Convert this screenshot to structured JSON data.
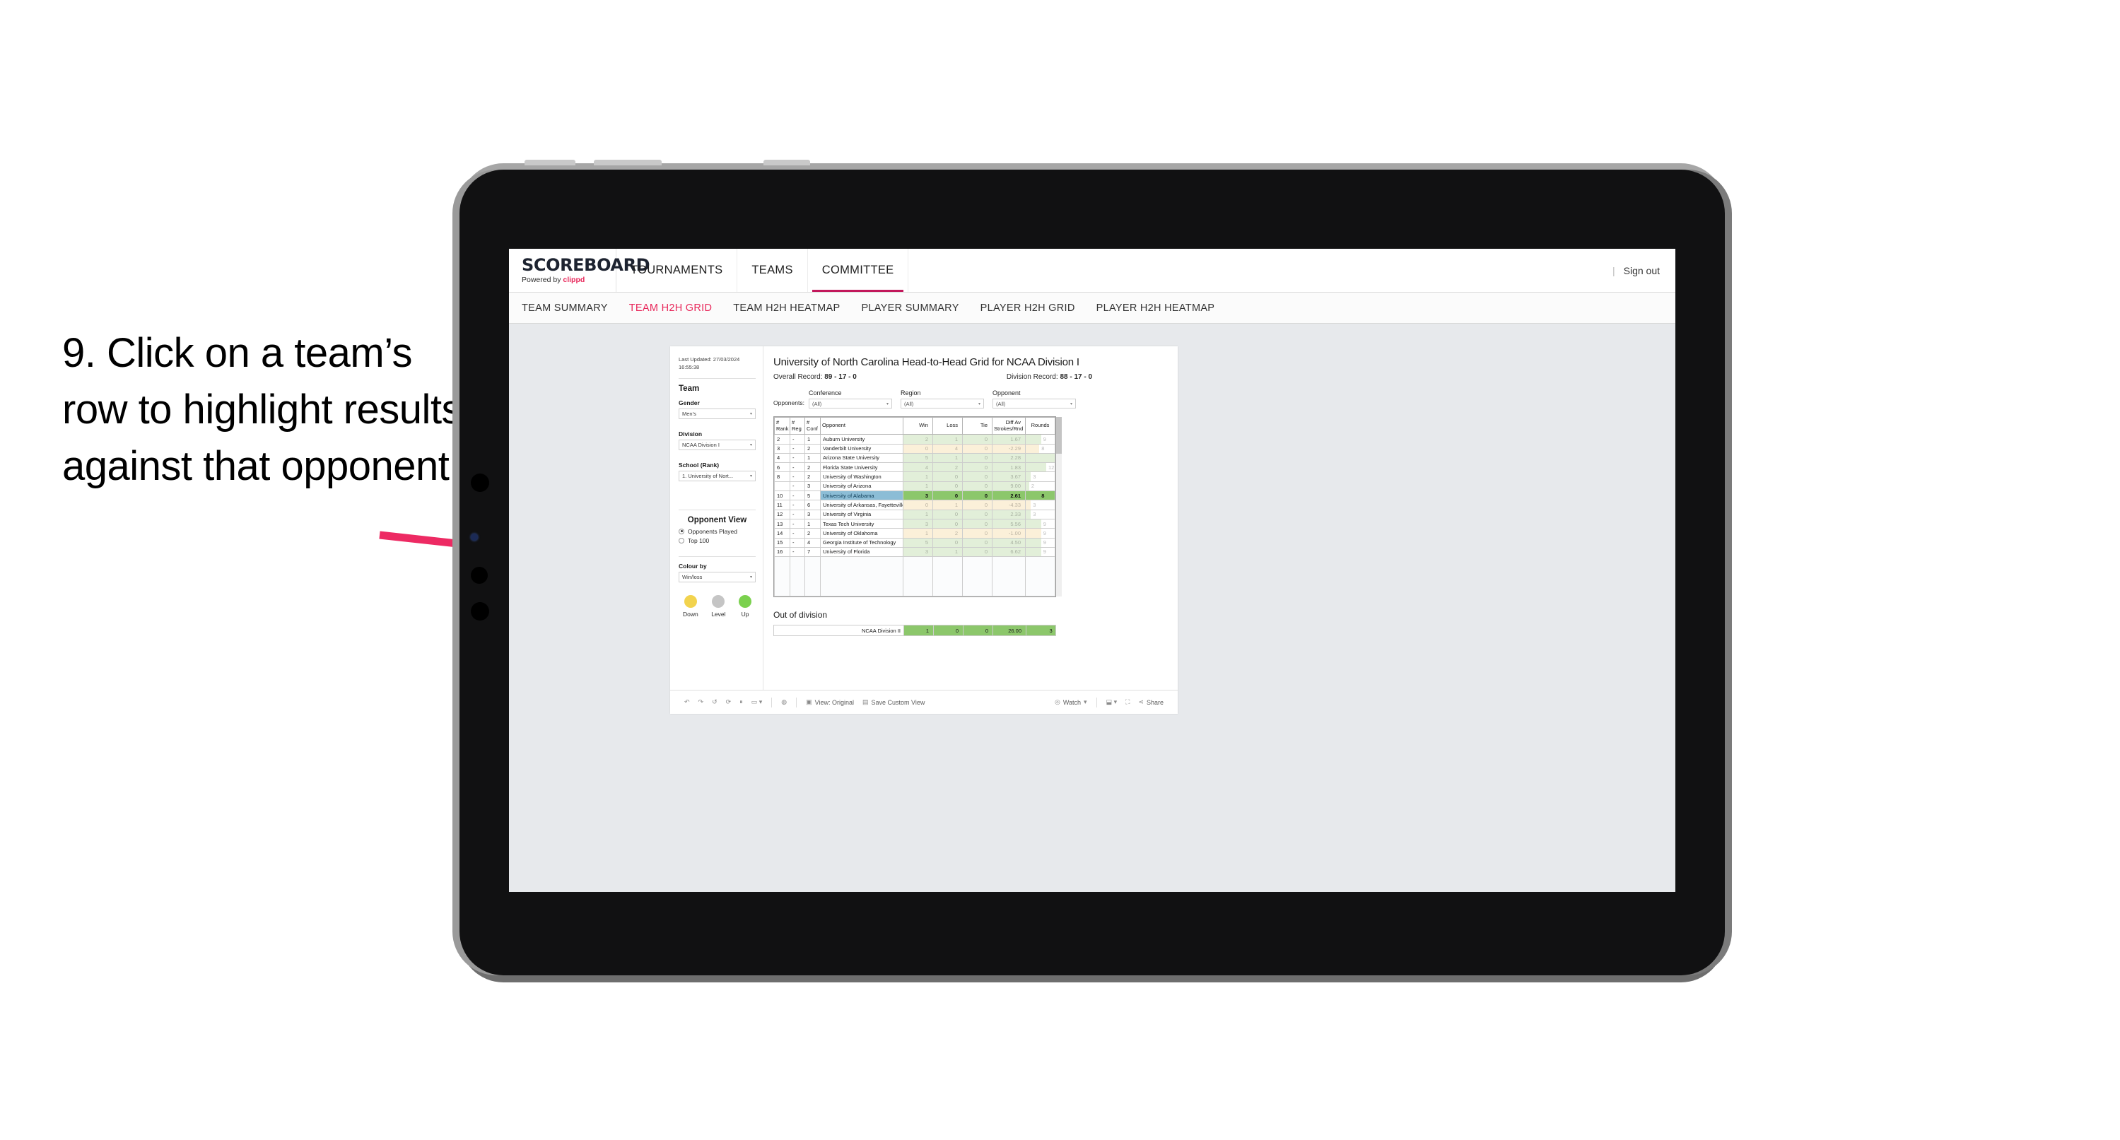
{
  "instruction": "9. Click on a team’s row to highlight results against that opponent",
  "brand": {
    "name": "SCOREBOARD",
    "powered_prefix": "Powered by ",
    "powered_brand": "clippd"
  },
  "topnav": {
    "tabs": [
      {
        "label": "TOURNAMENTS",
        "active": false
      },
      {
        "label": "TEAMS",
        "active": false
      },
      {
        "label": "COMMITTEE",
        "active": true
      }
    ],
    "signout": "Sign out",
    "separator": "|"
  },
  "subnav": {
    "tabs": [
      {
        "label": "TEAM SUMMARY",
        "active": false
      },
      {
        "label": "TEAM H2H GRID",
        "active": true
      },
      {
        "label": "TEAM H2H HEATMAP",
        "active": false
      },
      {
        "label": "PLAYER SUMMARY",
        "active": false
      },
      {
        "label": "PLAYER H2H GRID",
        "active": false
      },
      {
        "label": "PLAYER H2H HEATMAP",
        "active": false
      }
    ]
  },
  "sidebar": {
    "last_updated": "Last Updated: 27/03/2024 16:55:38",
    "team_heading": "Team",
    "gender": {
      "label": "Gender",
      "value": "Men’s"
    },
    "division": {
      "label": "Division",
      "value": "NCAA Division I"
    },
    "school": {
      "label": "School (Rank)",
      "value": "1. University of Nort..."
    },
    "opponent_view": {
      "heading": "Opponent View",
      "options": [
        {
          "label": "Opponents Played",
          "selected": true
        },
        {
          "label": "Top 100",
          "selected": false
        }
      ]
    },
    "colour_by": {
      "label": "Colour by",
      "value": "Win/loss"
    },
    "legend": [
      {
        "label": "Down",
        "color": "#f2d34e"
      },
      {
        "label": "Level",
        "color": "#c5c5c5"
      },
      {
        "label": "Up",
        "color": "#7bd14e"
      }
    ]
  },
  "main": {
    "title": "University of North Carolina Head-to-Head Grid for NCAA Division I",
    "overall_record_label": "Overall Record: ",
    "overall_record_value": "89 - 17 - 0",
    "division_record_label": "Division Record: ",
    "division_record_value": "88 - 17 - 0",
    "opponents_label": "Opponents:",
    "filters": [
      {
        "caption": "Conference",
        "value": "(All)"
      },
      {
        "caption": "Region",
        "value": "(All)"
      },
      {
        "caption": "Opponent",
        "value": "(All)"
      }
    ],
    "out_of_division_heading": "Out of division"
  },
  "chart_data": {
    "type": "table",
    "title": "University of North Carolina Head-to-Head Grid for NCAA Division I",
    "columns": [
      "# Rank",
      "# Reg",
      "# Conf",
      "Opponent",
      "Win",
      "Loss",
      "Tie",
      "Diff Av Strokes/Rnd",
      "Rounds"
    ],
    "rounds_max": 17,
    "rows": [
      {
        "rank": "2",
        "reg": "-",
        "conf": "1",
        "opponent": "Auburn University",
        "win": "2",
        "loss": "1",
        "tie": "0",
        "diff": "1.67",
        "rounds": 9,
        "state": "up",
        "selected": false
      },
      {
        "rank": "3",
        "reg": "-",
        "conf": "2",
        "opponent": "Vanderbilt University",
        "win": "0",
        "loss": "4",
        "tie": "0",
        "diff": "-2.29",
        "rounds": 8,
        "state": "down",
        "selected": false
      },
      {
        "rank": "4",
        "reg": "-",
        "conf": "1",
        "opponent": "Arizona State University",
        "win": "5",
        "loss": "1",
        "tie": "0",
        "diff": "2.28",
        "rounds": 17,
        "state": "up",
        "selected": false
      },
      {
        "rank": "6",
        "reg": "-",
        "conf": "2",
        "opponent": "Florida State University",
        "win": "4",
        "loss": "2",
        "tie": "0",
        "diff": "1.83",
        "rounds": 12,
        "state": "up",
        "selected": false
      },
      {
        "rank": "8",
        "reg": "-",
        "conf": "2",
        "opponent": "University of Washington",
        "win": "1",
        "loss": "0",
        "tie": "0",
        "diff": "3.67",
        "rounds": 3,
        "state": "up",
        "selected": false
      },
      {
        "rank": "",
        "reg": "-",
        "conf": "3",
        "opponent": "University of Arizona",
        "win": "1",
        "loss": "0",
        "tie": "0",
        "diff": "9.00",
        "rounds": 2,
        "state": "up",
        "selected": false
      },
      {
        "rank": "10",
        "reg": "-",
        "conf": "5",
        "opponent": "University of Alabama",
        "win": "3",
        "loss": "0",
        "tie": "0",
        "diff": "2.61",
        "rounds": 8,
        "state": "up",
        "selected": true
      },
      {
        "rank": "11",
        "reg": "-",
        "conf": "6",
        "opponent": "University of Arkansas, Fayetteville",
        "win": "0",
        "loss": "1",
        "tie": "0",
        "diff": "-4.33",
        "rounds": 3,
        "state": "down",
        "selected": false
      },
      {
        "rank": "12",
        "reg": "-",
        "conf": "3",
        "opponent": "University of Virginia",
        "win": "1",
        "loss": "0",
        "tie": "0",
        "diff": "2.33",
        "rounds": 3,
        "state": "up",
        "selected": false
      },
      {
        "rank": "13",
        "reg": "-",
        "conf": "1",
        "opponent": "Texas Tech University",
        "win": "3",
        "loss": "0",
        "tie": "0",
        "diff": "5.56",
        "rounds": 9,
        "state": "up",
        "selected": false
      },
      {
        "rank": "14",
        "reg": "-",
        "conf": "2",
        "opponent": "University of Oklahoma",
        "win": "1",
        "loss": "2",
        "tie": "0",
        "diff": "-1.00",
        "rounds": 9,
        "state": "down",
        "selected": false
      },
      {
        "rank": "15",
        "reg": "-",
        "conf": "4",
        "opponent": "Georgia Institute of Technology",
        "win": "5",
        "loss": "0",
        "tie": "0",
        "diff": "4.50",
        "rounds": 9,
        "state": "up",
        "selected": false
      },
      {
        "rank": "16",
        "reg": "-",
        "conf": "7",
        "opponent": "University of Florida",
        "win": "3",
        "loss": "1",
        "tie": "0",
        "diff": "6.62",
        "rounds": 9,
        "state": "up",
        "selected": false
      }
    ],
    "out_of_division": [
      {
        "label": "NCAA Division II",
        "win": "1",
        "loss": "0",
        "tie": "0",
        "diff": "26.00",
        "rounds": "3"
      }
    ]
  },
  "toolbar": {
    "view_original": "View: Original",
    "save_custom_view": "Save Custom View",
    "watch": "Watch",
    "share": "Share"
  },
  "colors": {
    "accent": "#e8275a",
    "highlight_green": "#8cc76b",
    "highlight_blue": "#8cbdd6",
    "up_tint": "#e2efd9",
    "down_tint": "#fbf0d9",
    "arrow": "#ed2a63"
  }
}
